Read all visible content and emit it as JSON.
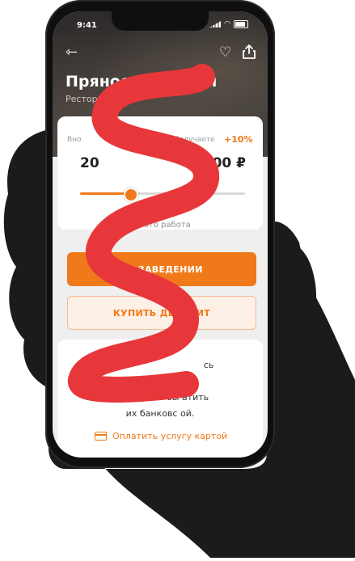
{
  "status": {
    "time": "9:41"
  },
  "place": {
    "title": "Пряности и ра  ти",
    "subtitle": "Ресторан"
  },
  "deposit": {
    "label_left": "Вно",
    "label_right": "Получаете",
    "bonus_percent": "+10%",
    "amount_left": "20",
    "amount_right": "0 000 ₽",
    "slider_fraction": 0.3
  },
  "how_it_works": "Как это работа",
  "buttons": {
    "primary": "ОТ         ЗАВЕДЕНИИ",
    "secondary": "КУПИТЬ ДЕПОЗИТ"
  },
  "info": {
    "lines": [
      "сь",
      "услуг        ения?",
      "Вы можете бы        атить",
      "их банковс        ой."
    ]
  },
  "pay_link": "Оплатить услугу картой",
  "colors": {
    "accent": "#f07a1a",
    "scribble": "#e8373a",
    "hand": "#1b1b1b"
  },
  "icons": [
    "back-icon",
    "heart-icon",
    "share-icon",
    "info-icon",
    "card-icon"
  ]
}
